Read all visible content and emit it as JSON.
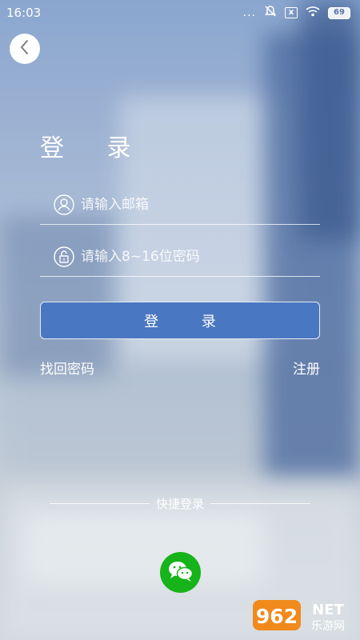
{
  "status_bar": {
    "time": "16:03",
    "dots": "...",
    "sim_icon": "x",
    "battery": "69"
  },
  "header": {
    "back_icon": "chevron-left-icon"
  },
  "title": "登 录",
  "form": {
    "email_placeholder": "请输入邮箱",
    "email_value": "",
    "password_placeholder": "请输入8~16位密码",
    "password_value": "",
    "login_label": "登 录"
  },
  "links": {
    "forgot": "找回密码",
    "register": "注册"
  },
  "quick_login": {
    "label": "快捷登录",
    "wechat_icon": "wechat-icon"
  },
  "watermark": {
    "number": "962",
    "suffix": "NET",
    "sub": "乐游网"
  },
  "colors": {
    "primary_button": "#4a77c1",
    "wechat": "#17b31a",
    "watermark_orange": "#f08a1c"
  }
}
